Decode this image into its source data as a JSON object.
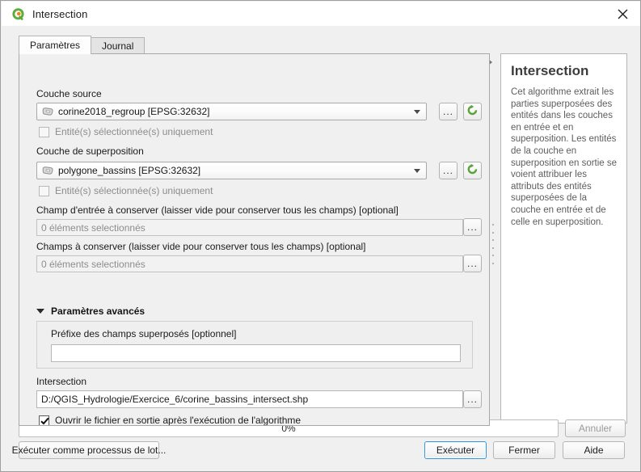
{
  "window": {
    "title": "Intersection",
    "icon": "qgis-logo-icon",
    "close_label": "close-icon"
  },
  "tabs": [
    {
      "label": "Paramètres",
      "active": true
    },
    {
      "label": "Journal",
      "active": false
    }
  ],
  "parameters": {
    "source_layer": {
      "label": "Couche source",
      "value": "corine2018_regroup [EPSG:32632]",
      "browse_label": "...",
      "iterate_label": "iterate-icon"
    },
    "source_selected_only": {
      "label": "Entité(s) sélectionnée(s) uniquement",
      "checked": false,
      "enabled": false
    },
    "overlay_layer": {
      "label": "Couche de superposition",
      "value": "polygone_bassins [EPSG:32632]",
      "browse_label": "...",
      "iterate_label": "iterate-icon"
    },
    "overlay_selected_only": {
      "label": "Entité(s) sélectionnée(s) uniquement",
      "checked": false,
      "enabled": false
    },
    "input_fields": {
      "label": "Champ d'entrée à conserver (laisser vide pour conserver tous les champs) [optional]",
      "value": "0 éléments selectionnés",
      "browse_label": "..."
    },
    "overlay_fields": {
      "label": "Champs à conserver (laisser vide pour conserver tous les champs) [optional]",
      "value": "0 éléments selectionnés",
      "browse_label": "..."
    },
    "advanced": {
      "label": "Paramètres avancés",
      "expanded": true,
      "prefix": {
        "label": "Préfixe des champs superposés [optionnel]",
        "value": ""
      }
    },
    "output": {
      "label": "Intersection",
      "value": "D:/QGIS_Hydrologie/Exercice_6/corine_bassins_intersect.shp",
      "browse_label": "..."
    },
    "open_output": {
      "label": "Ouvrir le fichier en sortie après l'exécution de l'algorithme",
      "checked": true
    }
  },
  "description": {
    "title": "Intersection",
    "body": "Cet algorithme extrait les parties superposées des entités dans les couches en entrée et en superposition. Les entités de la couche en superposition en sortie se voient attribuer les attributs des entités superposées de la couche en entrée et de celle en superposition."
  },
  "footer": {
    "progress_text": "0%",
    "progress_percent": 0,
    "cancel_label": "Annuler",
    "batch_label": "Exécuter comme processus de lot...",
    "run_label": "Exécuter",
    "close_label": "Fermer",
    "help_label": "Aide"
  },
  "colors": {
    "accent": "#2f97e0",
    "qgis_green": "#5faa3d",
    "qgis_orange": "#e8861b",
    "dialog_bg": "#f0f0f0"
  }
}
